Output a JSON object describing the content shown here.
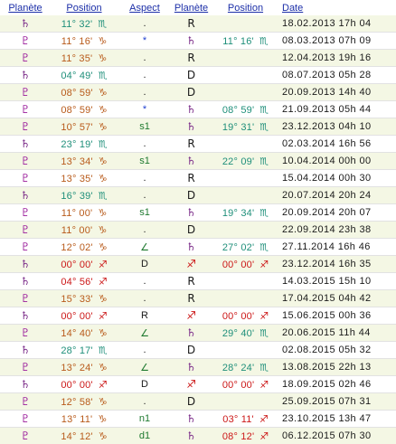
{
  "headers": [
    "Planète",
    "Position",
    "Aspect",
    "Planète",
    "Position",
    "Date"
  ],
  "colors": {
    "saturn": "#7a2a88",
    "pluto": "#9a1a9a",
    "scorpio": "#1f8f7a",
    "capricorn": "#b85a1a",
    "sagittarius": "#cc1818",
    "dot": "#222222",
    "sextile": "#1f3fd0",
    "text": "#1a1a1a"
  },
  "rows": [
    {
      "p1": "♄",
      "pos1": "11° 32'",
      "s1": "♏",
      "asp": ".",
      "p2": "R",
      "pos2": "",
      "s2": "",
      "date": "18.02.2013 17h 04"
    },
    {
      "p1": "♇",
      "pos1": "11° 16'",
      "s1": "♑",
      "asp": "*",
      "p2": "♄",
      "pos2": "11° 16'",
      "s2": "♏",
      "date": "08.03.2013 07h 09"
    },
    {
      "p1": "♇",
      "pos1": "11° 35'",
      "s1": "♑",
      "asp": ".",
      "p2": "R",
      "pos2": "",
      "s2": "",
      "date": "12.04.2013 19h 16"
    },
    {
      "p1": "♄",
      "pos1": "04° 49'",
      "s1": "♏",
      "asp": ".",
      "p2": "D",
      "pos2": "",
      "s2": "",
      "date": "08.07.2013 05h 28"
    },
    {
      "p1": "♇",
      "pos1": "08° 59'",
      "s1": "♑",
      "asp": ".",
      "p2": "D",
      "pos2": "",
      "s2": "",
      "date": "20.09.2013 14h 40"
    },
    {
      "p1": "♇",
      "pos1": "08° 59'",
      "s1": "♑",
      "asp": "*",
      "p2": "♄",
      "pos2": "08° 59'",
      "s2": "♏",
      "date": "21.09.2013 05h 44"
    },
    {
      "p1": "♇",
      "pos1": "10° 57'",
      "s1": "♑",
      "asp": "s1",
      "p2": "♄",
      "pos2": "19° 31'",
      "s2": "♏",
      "date": "23.12.2013 04h 10"
    },
    {
      "p1": "♄",
      "pos1": "23° 19'",
      "s1": "♏",
      "asp": ".",
      "p2": "R",
      "pos2": "",
      "s2": "",
      "date": "02.03.2014 16h 56"
    },
    {
      "p1": "♇",
      "pos1": "13° 34'",
      "s1": "♑",
      "asp": "s1",
      "p2": "♄",
      "pos2": "22° 09'",
      "s2": "♏",
      "date": "10.04.2014 00h 00"
    },
    {
      "p1": "♇",
      "pos1": "13° 35'",
      "s1": "♑",
      "asp": ".",
      "p2": "R",
      "pos2": "",
      "s2": "",
      "date": "15.04.2014 00h 30"
    },
    {
      "p1": "♄",
      "pos1": "16° 39'",
      "s1": "♏",
      "asp": ".",
      "p2": "D",
      "pos2": "",
      "s2": "",
      "date": "20.07.2014 20h 24"
    },
    {
      "p1": "♇",
      "pos1": "11° 00'",
      "s1": "♑",
      "asp": "s1",
      "p2": "♄",
      "pos2": "19° 34'",
      "s2": "♏",
      "date": "20.09.2014 20h 07"
    },
    {
      "p1": "♇",
      "pos1": "11° 00'",
      "s1": "♑",
      "asp": ".",
      "p2": "D",
      "pos2": "",
      "s2": "",
      "date": "22.09.2014 23h 38"
    },
    {
      "p1": "♇",
      "pos1": "12° 02'",
      "s1": "♑",
      "asp": "∠",
      "p2": "♄",
      "pos2": "27° 02'",
      "s2": "♏",
      "date": "27.11.2014 16h 46"
    },
    {
      "p1": "♄",
      "pos1": "00° 00'",
      "s1": "♐",
      "asp": "D",
      "p2": "♐",
      "pos2": "00° 00'",
      "s2": "♐",
      "date": "23.12.2014 16h 35"
    },
    {
      "p1": "♄",
      "pos1": "04° 56'",
      "s1": "♐",
      "asp": ".",
      "p2": "R",
      "pos2": "",
      "s2": "",
      "date": "14.03.2015 15h 10"
    },
    {
      "p1": "♇",
      "pos1": "15° 33'",
      "s1": "♑",
      "asp": ".",
      "p2": "R",
      "pos2": "",
      "s2": "",
      "date": "17.04.2015 04h 42"
    },
    {
      "p1": "♄",
      "pos1": "00° 00'",
      "s1": "♐",
      "asp": "R",
      "p2": "♐",
      "pos2": "00° 00'",
      "s2": "♐",
      "date": "15.06.2015 00h 36"
    },
    {
      "p1": "♇",
      "pos1": "14° 40'",
      "s1": "♑",
      "asp": "∠",
      "p2": "♄",
      "pos2": "29° 40'",
      "s2": "♏",
      "date": "20.06.2015 11h 44"
    },
    {
      "p1": "♄",
      "pos1": "28° 17'",
      "s1": "♏",
      "asp": ".",
      "p2": "D",
      "pos2": "",
      "s2": "",
      "date": "02.08.2015 05h 32"
    },
    {
      "p1": "♇",
      "pos1": "13° 24'",
      "s1": "♑",
      "asp": "∠",
      "p2": "♄",
      "pos2": "28° 24'",
      "s2": "♏",
      "date": "13.08.2015 22h 13"
    },
    {
      "p1": "♄",
      "pos1": "00° 00'",
      "s1": "♐",
      "asp": "D",
      "p2": "♐",
      "pos2": "00° 00'",
      "s2": "♐",
      "date": "18.09.2015 02h 46"
    },
    {
      "p1": "♇",
      "pos1": "12° 58'",
      "s1": "♑",
      "asp": ".",
      "p2": "D",
      "pos2": "",
      "s2": "",
      "date": "25.09.2015 07h 31"
    },
    {
      "p1": "♇",
      "pos1": "13° 11'",
      "s1": "♑",
      "asp": "n1",
      "p2": "♄",
      "pos2": "03° 11'",
      "s2": "♐",
      "date": "23.10.2015 13h 47"
    },
    {
      "p1": "♇",
      "pos1": "14° 12'",
      "s1": "♑",
      "asp": "d1",
      "p2": "♄",
      "pos2": "08° 12'",
      "s2": "♐",
      "date": "06.12.2015 07h 30"
    }
  ]
}
